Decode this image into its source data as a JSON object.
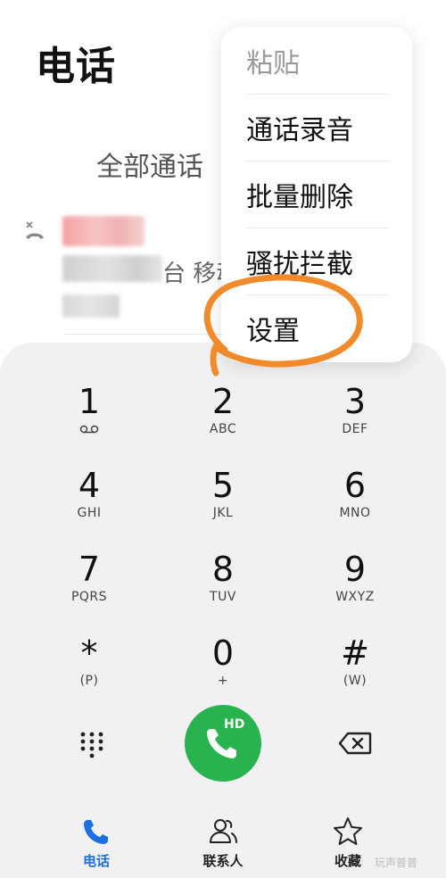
{
  "header": {
    "title": "电话"
  },
  "calls": {
    "tab_label": "全部通话",
    "entries": [
      {
        "location": "台 移动"
      }
    ]
  },
  "menu": {
    "items": [
      {
        "label": "粘贴",
        "disabled": true
      },
      {
        "label": "通话录音",
        "disabled": false
      },
      {
        "label": "批量删除",
        "disabled": false
      },
      {
        "label": "骚扰拦截",
        "disabled": false
      },
      {
        "label": "设置",
        "disabled": false
      }
    ]
  },
  "dialpad": {
    "keys": [
      {
        "digit": "1",
        "letters": ""
      },
      {
        "digit": "2",
        "letters": "ABC"
      },
      {
        "digit": "3",
        "letters": "DEF"
      },
      {
        "digit": "4",
        "letters": "GHI"
      },
      {
        "digit": "5",
        "letters": "JKL"
      },
      {
        "digit": "6",
        "letters": "MNO"
      },
      {
        "digit": "7",
        "letters": "PQRS"
      },
      {
        "digit": "8",
        "letters": "TUV"
      },
      {
        "digit": "9",
        "letters": "WXYZ"
      },
      {
        "digit": "*",
        "letters": "(P)"
      },
      {
        "digit": "0",
        "letters": "+"
      },
      {
        "digit": "#",
        "letters": "(W)"
      }
    ],
    "call_badge": "HD",
    "icons": {
      "toggle": "dialpad-grid-icon",
      "call": "phone-hd-icon",
      "backspace": "backspace-icon"
    }
  },
  "nav": {
    "items": [
      {
        "label": "电话",
        "icon": "phone-icon",
        "active": true
      },
      {
        "label": "联系人",
        "icon": "contacts-icon",
        "active": false
      },
      {
        "label": "收藏",
        "icon": "star-icon",
        "active": false
      }
    ]
  },
  "watermark": "玩声普普",
  "colors": {
    "accent": "#1b6fe0",
    "call_green": "#29b34f",
    "annotation_orange": "#f08a2a",
    "panel_bg": "#f1f1f4"
  }
}
